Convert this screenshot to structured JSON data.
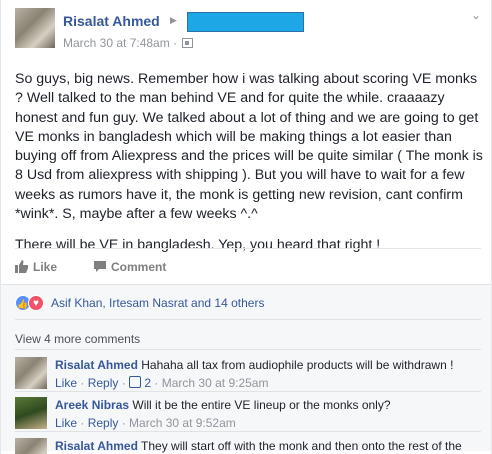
{
  "post": {
    "author": "Risalat Ahmed",
    "date": "March 30 at 7:48am",
    "paragraphs": [
      "So guys, big news. Remember how i was talking about scoring VE monks ? Well talked to the man behind VE and for quite the while. craaaazy honest and fun guy. We talked about a lot of thing and we are going to get VE monks in bangladesh which will be making things a lot easier than buying off from Aliexpress and the prices will be quite similar ( The monk is 8 Usd from aliexpress with shipping ). But you will have to wait for a few weeks as rumors have it, the monk is getting new revision, cant confirm *wink*. S, maybe after a few weeks ^.^",
      "There will be VE in bangladesh. Yep, you heard that right !"
    ]
  },
  "actions": {
    "like": "Like",
    "comment": "Comment"
  },
  "reactions": {
    "names": "Asif Khan, Irtesam Nasrat and 14 others"
  },
  "view_more": "View 4 more comments",
  "comments": [
    {
      "name": "Risalat Ahmed",
      "text": "Hahaha all tax from audiophile products will be withdrawn !",
      "like": "Like",
      "reply": "Reply",
      "likes": "2",
      "time": "March 30 at 9:25am"
    },
    {
      "name": "Areek Nibras",
      "text": "Will it be the entire VE lineup or the monks only?",
      "like": "Like",
      "reply": "Reply",
      "time": "March 30 at 9:52am"
    },
    {
      "name": "Risalat Ahmed",
      "text": "They will start off with the monk and then onto the rest of the"
    }
  ]
}
